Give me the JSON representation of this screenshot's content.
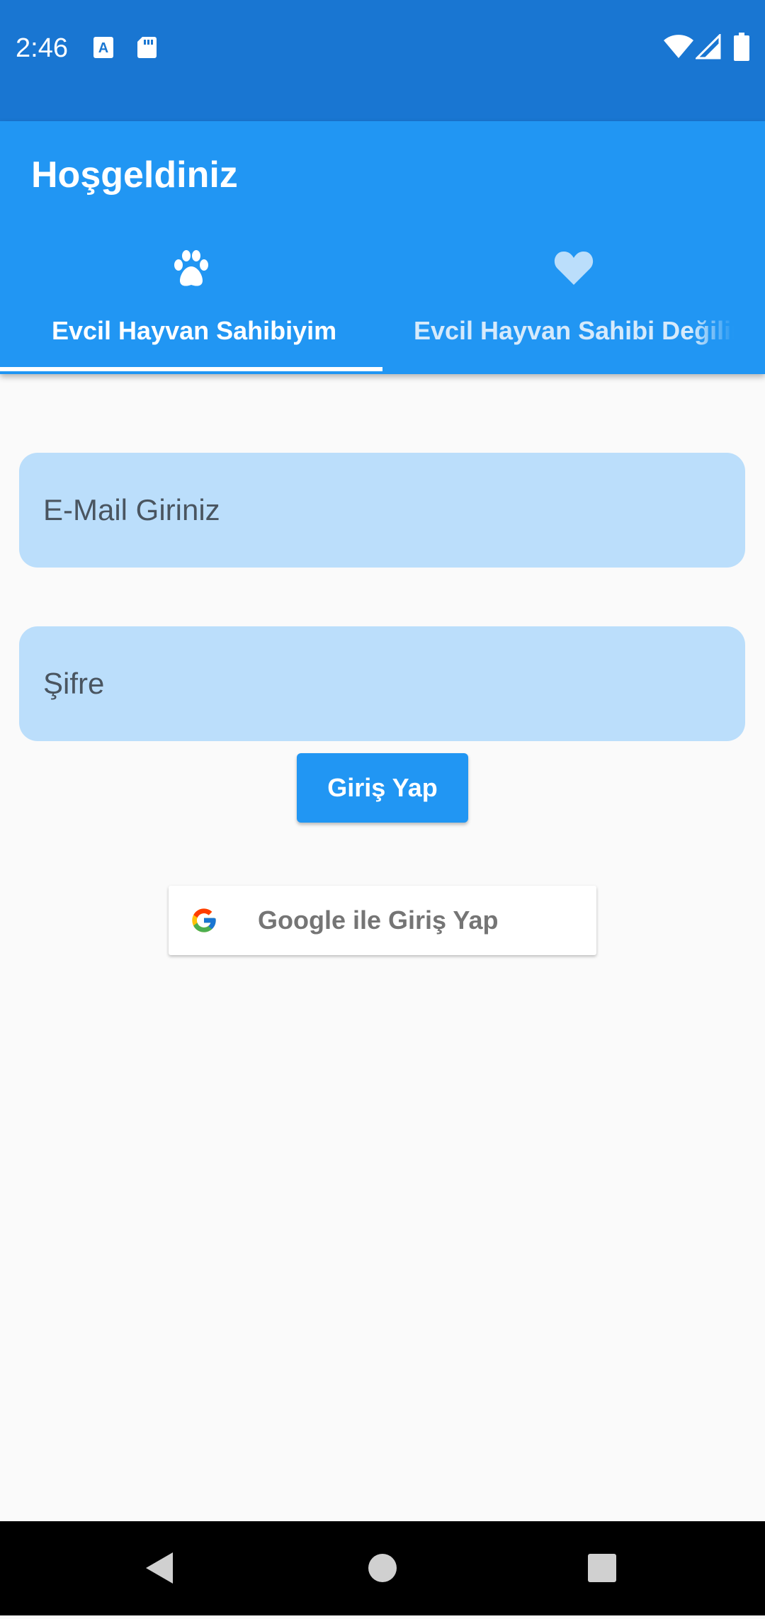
{
  "status_bar": {
    "time": "2:46",
    "icons": [
      "a-icon",
      "sd-card-icon",
      "wifi-icon",
      "signal-icon",
      "battery-icon"
    ],
    "background": "#1976D2"
  },
  "app_bar": {
    "title": "Hoşgeldiniz",
    "background": "#2196F3",
    "tabs": [
      {
        "label": "Evcil Hayvan Sahibiyim",
        "icon": "paw-icon",
        "selected": true
      },
      {
        "label": "Evcil Hayvan Sahibi Değilim",
        "icon": "heart-icon",
        "selected": false
      }
    ]
  },
  "form": {
    "email_placeholder": "E-Mail Giriniz",
    "password_placeholder": "Şifre",
    "login_label": "Giriş Yap",
    "google_label": "Google ile Giriş Yap",
    "field_color": "#BBDEFB",
    "button_color": "#2196F3"
  },
  "nav_bar": {
    "items": [
      "back-icon",
      "home-icon",
      "recents-icon"
    ]
  }
}
